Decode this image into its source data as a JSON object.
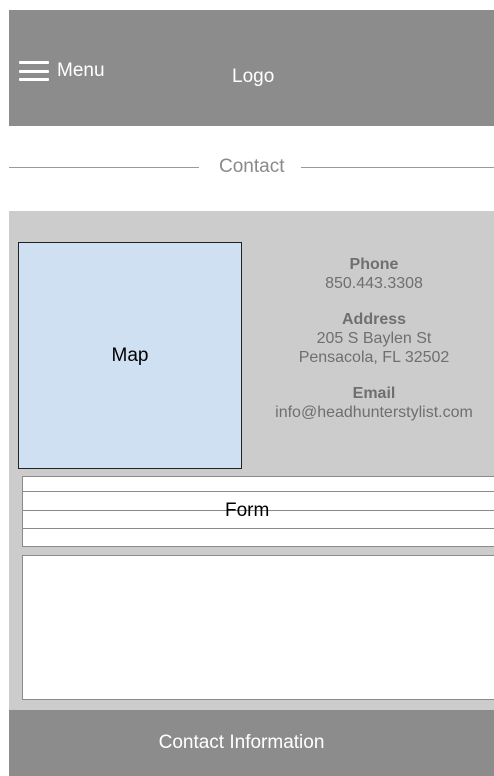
{
  "header": {
    "menu_label": "Menu",
    "logo_label": "Logo"
  },
  "section": {
    "title": "Contact"
  },
  "map": {
    "label": "Map"
  },
  "contact": {
    "phone_heading": "Phone",
    "phone": "850.443.3308",
    "address_heading": "Address",
    "address_line1": "205 S Baylen St",
    "address_line2": "Pensacola, FL 32502",
    "email_heading": "Email",
    "email": "info@headhunterstylist.com"
  },
  "form": {
    "label": "Form"
  },
  "footer": {
    "label": "Contact Information"
  },
  "colors": {
    "header_bg": "#8c8c8c",
    "content_bg": "#cccccc",
    "map_bg": "#cfe0f3"
  },
  "icons": {
    "menu": "hamburger-icon"
  }
}
